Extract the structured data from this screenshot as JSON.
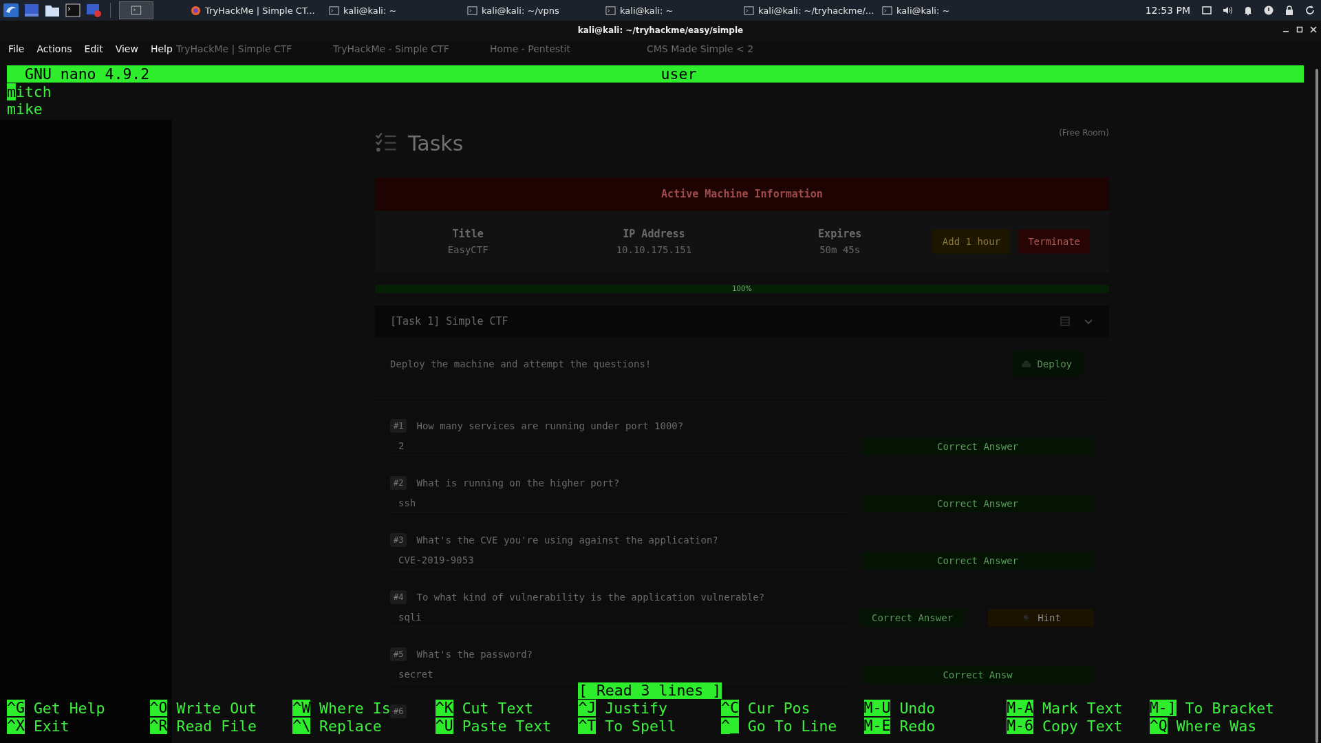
{
  "taskbar": {
    "windows": [
      {
        "title": "TryHackMe | Simple CT...",
        "kind": "browser"
      },
      {
        "title": "kali@kali: ~",
        "kind": "terminal"
      },
      {
        "title": "kali@kali: ~/vpns",
        "kind": "terminal"
      },
      {
        "title": "kali@kali: ~",
        "kind": "terminal"
      },
      {
        "title": "kali@kali: ~/tryhackme/...",
        "kind": "terminal"
      },
      {
        "title": "kali@kali: ~",
        "kind": "terminal"
      }
    ],
    "clock": "12:53 PM"
  },
  "window": {
    "title": "kali@kali: ~/tryhackme/easy/simple",
    "menu": [
      "File",
      "Actions",
      "Edit",
      "View",
      "Help"
    ]
  },
  "browser": {
    "tabs": [
      "TryHackMe | Simple CTF",
      "TryHackMe - Simple CTF",
      "Home - Pentestit",
      "CMS Made Simple < 2"
    ],
    "page": {
      "heading": "Tasks",
      "badge": "(Free Room)",
      "machine": {
        "title": "Active Machine Information",
        "fields": [
          {
            "label": "Title",
            "value": "EasyCTF"
          },
          {
            "label": "IP Address",
            "value": "10.10.175.151"
          },
          {
            "label": "Expires",
            "value": "50m 45s"
          }
        ],
        "buttons": [
          {
            "label": "Add 1 hour",
            "kind": "warning"
          },
          {
            "label": "Terminate",
            "kind": "danger"
          }
        ]
      },
      "progress": {
        "label": "100%",
        "level": 1
      },
      "task": {
        "title": "[Task 1] Simple CTF",
        "intro": "Deploy the machine and attempt the questions!",
        "deploy": "Deploy",
        "questions": [
          {
            "number": "#1",
            "text": "How many services are running under port 1000?",
            "answer": "2",
            "buttons": [
              {
                "label": "Correct Answer",
                "kind": "correct"
              }
            ]
          },
          {
            "number": "#2",
            "text": "What is running on the higher port?",
            "answer": "ssh",
            "buttons": [
              {
                "label": "Correct Answer",
                "kind": "correct"
              }
            ]
          },
          {
            "number": "#3",
            "text": "What's the CVE you're using against the application?",
            "answer": "CVE-2019-9053",
            "buttons": [
              {
                "label": "Correct Answer",
                "kind": "correct"
              }
            ]
          },
          {
            "number": "#4",
            "text": "To what kind of vulnerability is the application vulnerable?",
            "answer": "sqli",
            "buttons": [
              {
                "label": "Correct Answer",
                "kind": "correct"
              },
              {
                "label": "Hint",
                "kind": "hint"
              }
            ]
          },
          {
            "number": "#5",
            "text": "What's the password?",
            "answer": "secret",
            "buttons": [
              {
                "label": "Correct Answ",
                "kind": "correct"
              }
            ]
          },
          {
            "number": "#6"
          }
        ]
      }
    }
  },
  "nano": {
    "version": "GNU nano 4.9.2",
    "filename": "user",
    "lines": [
      {
        "text": "mitch",
        "cursor": true
      },
      {
        "text": "mike",
        "cursor": false
      }
    ],
    "status": "[ Read 3 lines ]",
    "shortcuts": [
      [
        {
          "key": "^G",
          "label": "Get Help"
        },
        {
          "key": "^X",
          "label": "Exit"
        }
      ],
      [
        {
          "key": "^O",
          "label": "Write Out"
        },
        {
          "key": "^R",
          "label": "Read File"
        }
      ],
      [
        {
          "key": "^W",
          "label": "Where Is"
        },
        {
          "key": "^\\",
          "label": "Replace"
        }
      ],
      [
        {
          "key": "^K",
          "label": "Cut Text"
        },
        {
          "key": "^U",
          "label": "Paste Text"
        }
      ],
      [
        {
          "key": "^J",
          "label": "Justify"
        },
        {
          "key": "^T",
          "label": "To Spell"
        }
      ],
      [
        {
          "key": "^C",
          "label": "Cur Pos"
        },
        {
          "key": "^_",
          "label": "Go To Line"
        }
      ],
      [
        {
          "key": "M-U",
          "label": "Undo"
        },
        {
          "key": "M-E",
          "label": "Redo"
        }
      ],
      [
        {
          "key": "M-A",
          "label": "Mark Text"
        },
        {
          "key": "M-6",
          "label": "Copy Text"
        }
      ],
      [
        {
          "key": "M-]",
          "label": "To Bracket"
        },
        {
          "key": "^Q",
          "label": "Where Was"
        }
      ]
    ]
  }
}
